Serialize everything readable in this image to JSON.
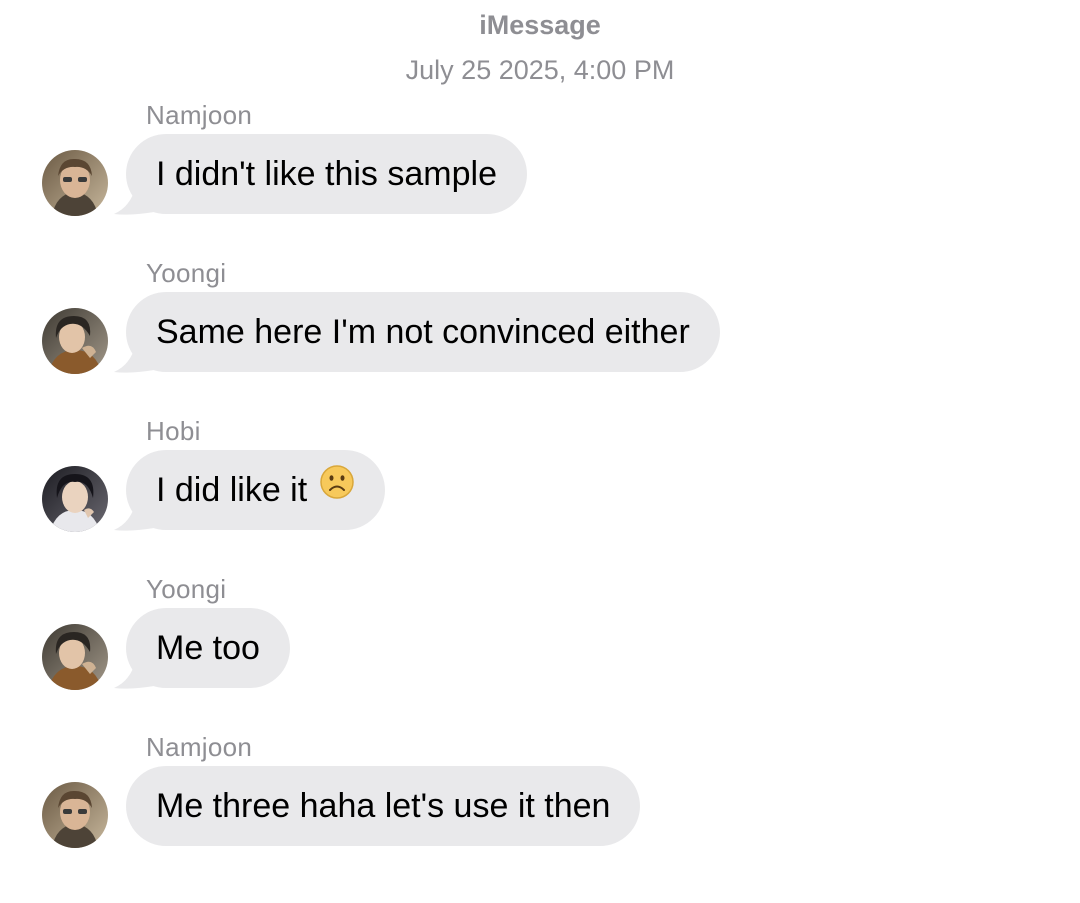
{
  "header": {
    "service": "iMessage",
    "timestamp": "July 25 2025, 4:00 PM"
  },
  "colors": {
    "bubble": "#e9e9eb",
    "meta_text": "#8e8e93"
  },
  "messages": [
    {
      "sender": "Namjoon",
      "text": "I didn't like this sample",
      "avatar": "avatar-namjoon"
    },
    {
      "sender": "Yoongi",
      "text": "Same here I'm not convinced either",
      "avatar": "avatar-yoongi"
    },
    {
      "sender": "Hobi",
      "text": "I did like it",
      "emoji": "frowning-face-icon",
      "avatar": "avatar-hobi"
    },
    {
      "sender": "Yoongi",
      "text": "Me too",
      "avatar": "avatar-yoongi"
    },
    {
      "sender": "Namjoon",
      "text": "Me three haha let's use it then",
      "avatar": "avatar-namjoon"
    }
  ]
}
